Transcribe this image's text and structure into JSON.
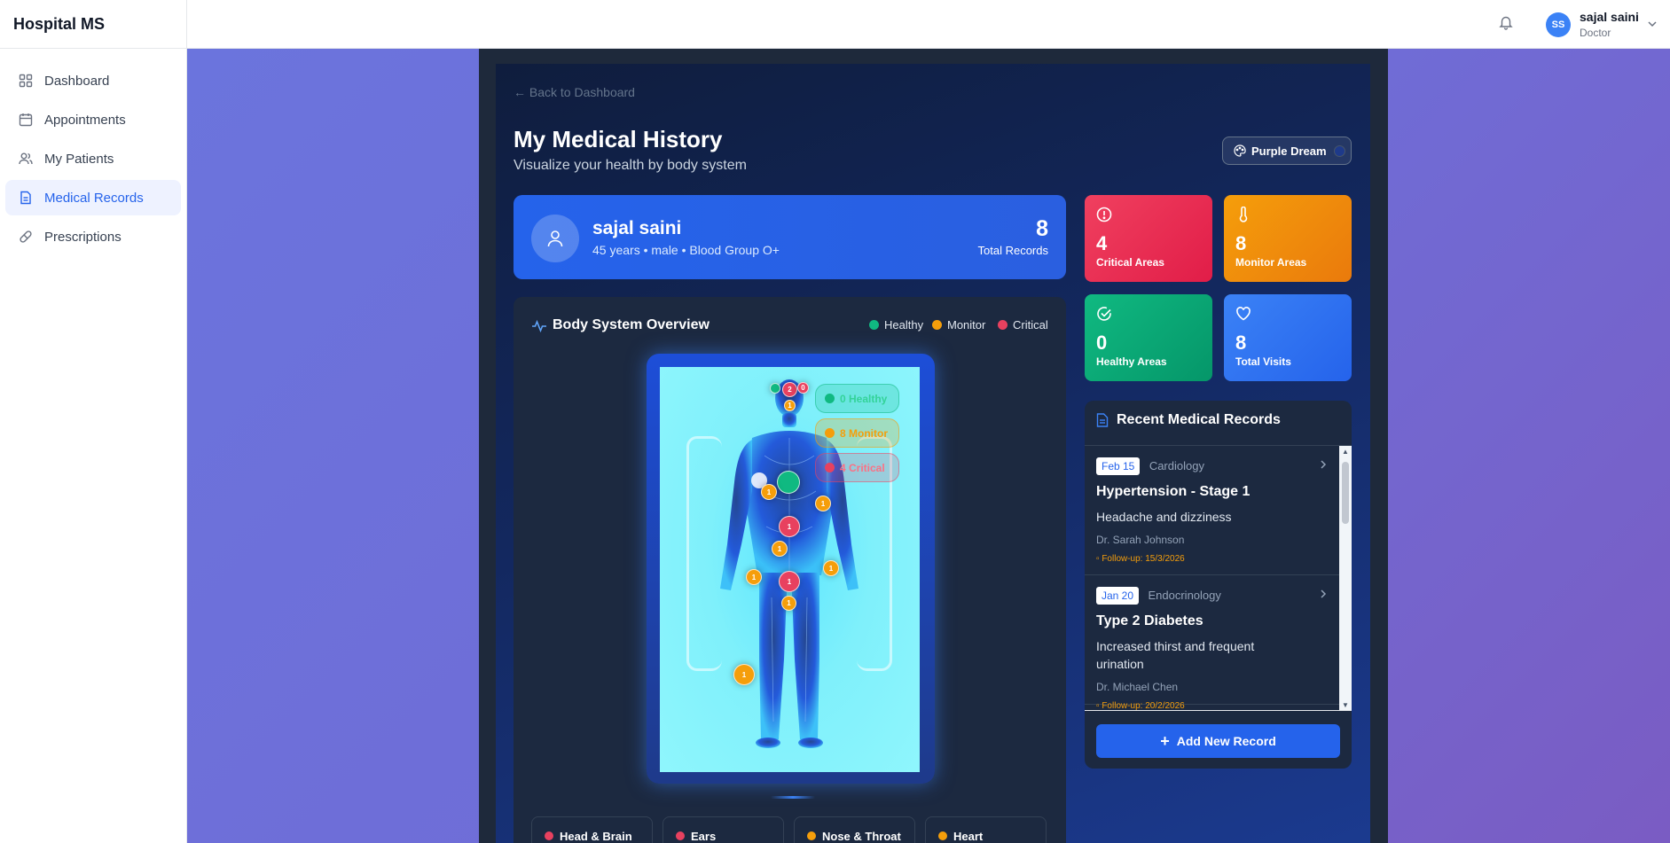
{
  "app": {
    "brand": "Hospital MS"
  },
  "sidebar": {
    "items": [
      {
        "label": "Dashboard",
        "icon": "grid-icon"
      },
      {
        "label": "Appointments",
        "icon": "calendar-icon"
      },
      {
        "label": "My Patients",
        "icon": "users-icon"
      },
      {
        "label": "Medical Records",
        "icon": "document-icon",
        "active": true
      },
      {
        "label": "Prescriptions",
        "icon": "pill-icon"
      }
    ]
  },
  "header": {
    "avatar_initials": "SS",
    "user_name": "sajal saini",
    "user_role": "Doctor"
  },
  "page": {
    "back_link": "← Back to Dashboard",
    "title": "My Medical History",
    "subtitle": "Visualize your health by body system",
    "theme_label": "Purple Dream"
  },
  "profile": {
    "name": "sajal saini",
    "meta": "45 years • male • Blood Group O+",
    "total_records": "8",
    "total_records_label": "Total Records"
  },
  "stats": {
    "critical": {
      "value": "4",
      "label": "Critical Areas"
    },
    "monitor": {
      "value": "8",
      "label": "Monitor Areas"
    },
    "healthy": {
      "value": "0",
      "label": "Healthy Areas"
    },
    "visits": {
      "value": "8",
      "label": "Total Visits"
    }
  },
  "overview": {
    "title": "Body System Overview",
    "legend": [
      "Healthy",
      "Monitor",
      "Critical"
    ],
    "chips": {
      "healthy": "0 Healthy",
      "monitor": "8 Monitor",
      "critical": "4 Critical"
    },
    "markers": [
      {
        "status": "healthy",
        "label": ""
      },
      {
        "status": "critical",
        "label": "2"
      },
      {
        "status": "critical",
        "label": "0"
      },
      {
        "status": "monitor",
        "label": "1"
      },
      {
        "status": "healthy",
        "label": ""
      },
      {
        "status": "monitor",
        "label": "1"
      },
      {
        "status": "monitor",
        "label": "1"
      },
      {
        "status": "critical",
        "label": "1"
      },
      {
        "status": "monitor",
        "label": "1"
      },
      {
        "status": "monitor",
        "label": "1"
      },
      {
        "status": "monitor",
        "label": "1"
      },
      {
        "status": "critical",
        "label": "1"
      },
      {
        "status": "monitor",
        "label": "1"
      },
      {
        "status": "monitor",
        "label": "1"
      }
    ],
    "tiles": [
      {
        "label": "Head & Brain",
        "status": "critical"
      },
      {
        "label": "Ears",
        "status": "critical"
      },
      {
        "label": "Nose & Throat",
        "status": "monitor"
      },
      {
        "label": "Heart",
        "status": "monitor"
      }
    ]
  },
  "records": {
    "title": "Recent Medical Records",
    "items": [
      {
        "date": "Feb 15",
        "department": "Cardiology",
        "title": "Hypertension - Stage 1",
        "description": "Headache and dizziness",
        "doctor": "Dr. Sarah Johnson",
        "follow_up": "Follow-up: 15/3/2026"
      },
      {
        "date": "Jan 20",
        "department": "Endocrinology",
        "title": "Type 2 Diabetes",
        "description": "Increased thirst and frequent urination",
        "doctor": "Dr. Michael Chen",
        "follow_up": "Follow-up: 20/2/2026"
      }
    ],
    "add_button": "Add New Record"
  },
  "colors": {
    "primary": "#2563eb",
    "critical": "#e8415f",
    "monitor": "#f59e0b",
    "healthy": "#10b981"
  }
}
